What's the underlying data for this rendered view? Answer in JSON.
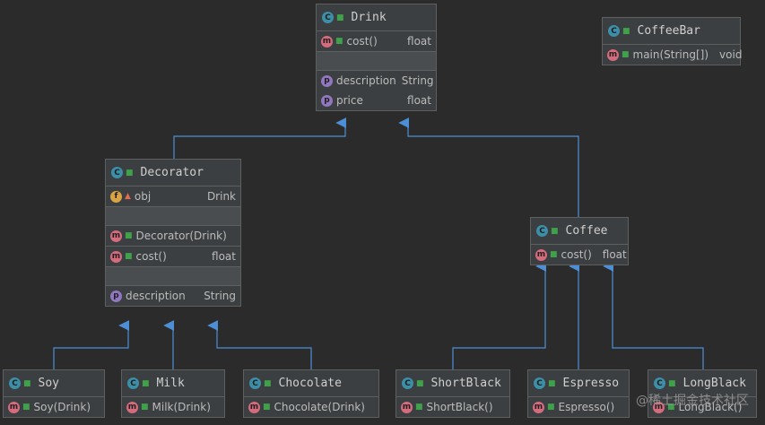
{
  "icons": {
    "class": "C",
    "method": "m",
    "property": "p",
    "field": "f",
    "public": "■",
    "private": "▲"
  },
  "drink": {
    "name": "Drink",
    "cost": "cost()",
    "cost_type": "float",
    "description": "description",
    "description_type": "String",
    "price": "price",
    "price_type": "float"
  },
  "coffeebar": {
    "name": "CoffeeBar",
    "main": "main(String[])",
    "main_type": "void"
  },
  "decorator": {
    "name": "Decorator",
    "obj": "obj",
    "obj_type": "Drink",
    "ctor": "Decorator(Drink)",
    "cost": "cost()",
    "cost_type": "float",
    "description": "description",
    "description_type": "String"
  },
  "coffee": {
    "name": "Coffee",
    "cost": "cost()",
    "cost_type": "float"
  },
  "soy": {
    "name": "Soy",
    "ctor": "Soy(Drink)"
  },
  "milk": {
    "name": "Milk",
    "ctor": "Milk(Drink)"
  },
  "chocolate": {
    "name": "Chocolate",
    "ctor": "Chocolate(Drink)"
  },
  "shortblack": {
    "name": "ShortBlack",
    "ctor": "ShortBlack()"
  },
  "espresso": {
    "name": "Espresso",
    "ctor": "Espresso()"
  },
  "longblack": {
    "name": "LongBlack",
    "ctor": "LongBlack()"
  },
  "watermark": "@稀土掘金技术社区",
  "colors": {
    "background": "#2b2b2b",
    "node": "#3c3f41",
    "border": "#5e6060",
    "edge": "#4d8fd6",
    "class_icon": "#3d8fa7",
    "method_icon": "#d46c7e",
    "property_icon": "#9177bf",
    "field_icon": "#d9a343"
  }
}
